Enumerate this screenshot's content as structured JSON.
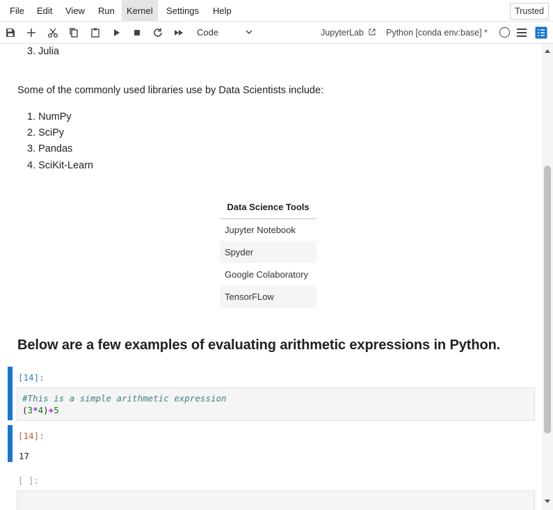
{
  "menu": {
    "items": [
      "File",
      "Edit",
      "View",
      "Run",
      "Kernel",
      "Settings",
      "Help"
    ],
    "active": "Kernel",
    "trusted_label": "Trusted"
  },
  "toolbar": {
    "cell_type": "Code",
    "jupyterlab_label": "JupyterLab",
    "kernel_label": "Python [conda env:base] *"
  },
  "notebook": {
    "languages_tail": [
      "3. Julia"
    ],
    "libraries_intro": "Some of the commonly used libraries use by Data Scientists include:",
    "libraries": [
      "1. NumPy",
      "2. SciPy",
      "3. Pandas",
      "4. SciKit-Learn"
    ],
    "tools_table": {
      "header": "Data Science Tools",
      "rows": [
        "Jupyter Notebook",
        "Spyder",
        "Google Colaboratory",
        "TensorFLow"
      ]
    },
    "heading": "Below are a few examples of evaluating arithmetic expressions in Python.",
    "code_cell": {
      "prompt": "[14]:",
      "comment": "#This is a simple arithmetic expression",
      "tokens": [
        "(",
        "3",
        "*",
        "4",
        ")",
        "+",
        "5"
      ]
    },
    "output_cell": {
      "prompt": "[14]:",
      "text": "17"
    },
    "empty_cell": {
      "prompt": "[ ]:"
    }
  },
  "colors": {
    "accent": "#1976d2",
    "in_prompt": "#307fc1",
    "out_prompt": "#bf5b3d",
    "comment": "#408080",
    "operator": "#aa22ff",
    "number": "#008000"
  }
}
